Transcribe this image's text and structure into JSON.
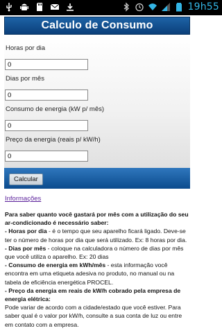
{
  "statusbar": {
    "time": "19h55",
    "left_icons": [
      "usb-icon",
      "android-icon",
      "sdcard-icon",
      "email-icon",
      "download-icon"
    ],
    "right_icons": [
      "bluetooth-icon",
      "alarm-icon",
      "wifi-icon",
      "signal-icon",
      "battery-icon"
    ]
  },
  "header": {
    "title": "Calculo de Consumo"
  },
  "form": {
    "fields": [
      {
        "label": "Horas por dia",
        "value": "0"
      },
      {
        "label": "Dias por mês",
        "value": "0"
      },
      {
        "label": "Consumo de energia (kW p/ mês)",
        "value": "0"
      },
      {
        "label": "Preço da energia (reais p/ kW/h)",
        "value": "0"
      }
    ],
    "calculate_label": "Calcular"
  },
  "info_link": "Informações",
  "info": {
    "intro": "Para saber quanto você gastará por mês com a utilização do seu ar-condicionado é necessário saber:",
    "hours_title": "- Horas por dia",
    "hours_text": " - é o tempo que seu aparelho ficará ligado. Deve-se ter o número de horas por dia que será utilizado. Ex: 8 horas por dia.",
    "days_title": "- Dias por mês",
    "days_text": " - coloque na calculadora o número de dias por mês que você utiliza o aparelho. Ex: 20 dias",
    "consumption_title": "- Consumo de energia em kWh/mês",
    "consumption_text": " - esta informação você encontra em uma etiqueta adesiva no produto, no manual ou na tabela de eficiência energética PROCEL.",
    "price_title": "- Preço da energia em reais de kW/h cobrado pela empresa de energia elétrica:",
    "price_text": "Pode variar de acordo com a cidade/estado que você estiver. Para saber qual é o valor por kW/h, consulte a sua conta de luz ou entre em contato com a empresa."
  }
}
